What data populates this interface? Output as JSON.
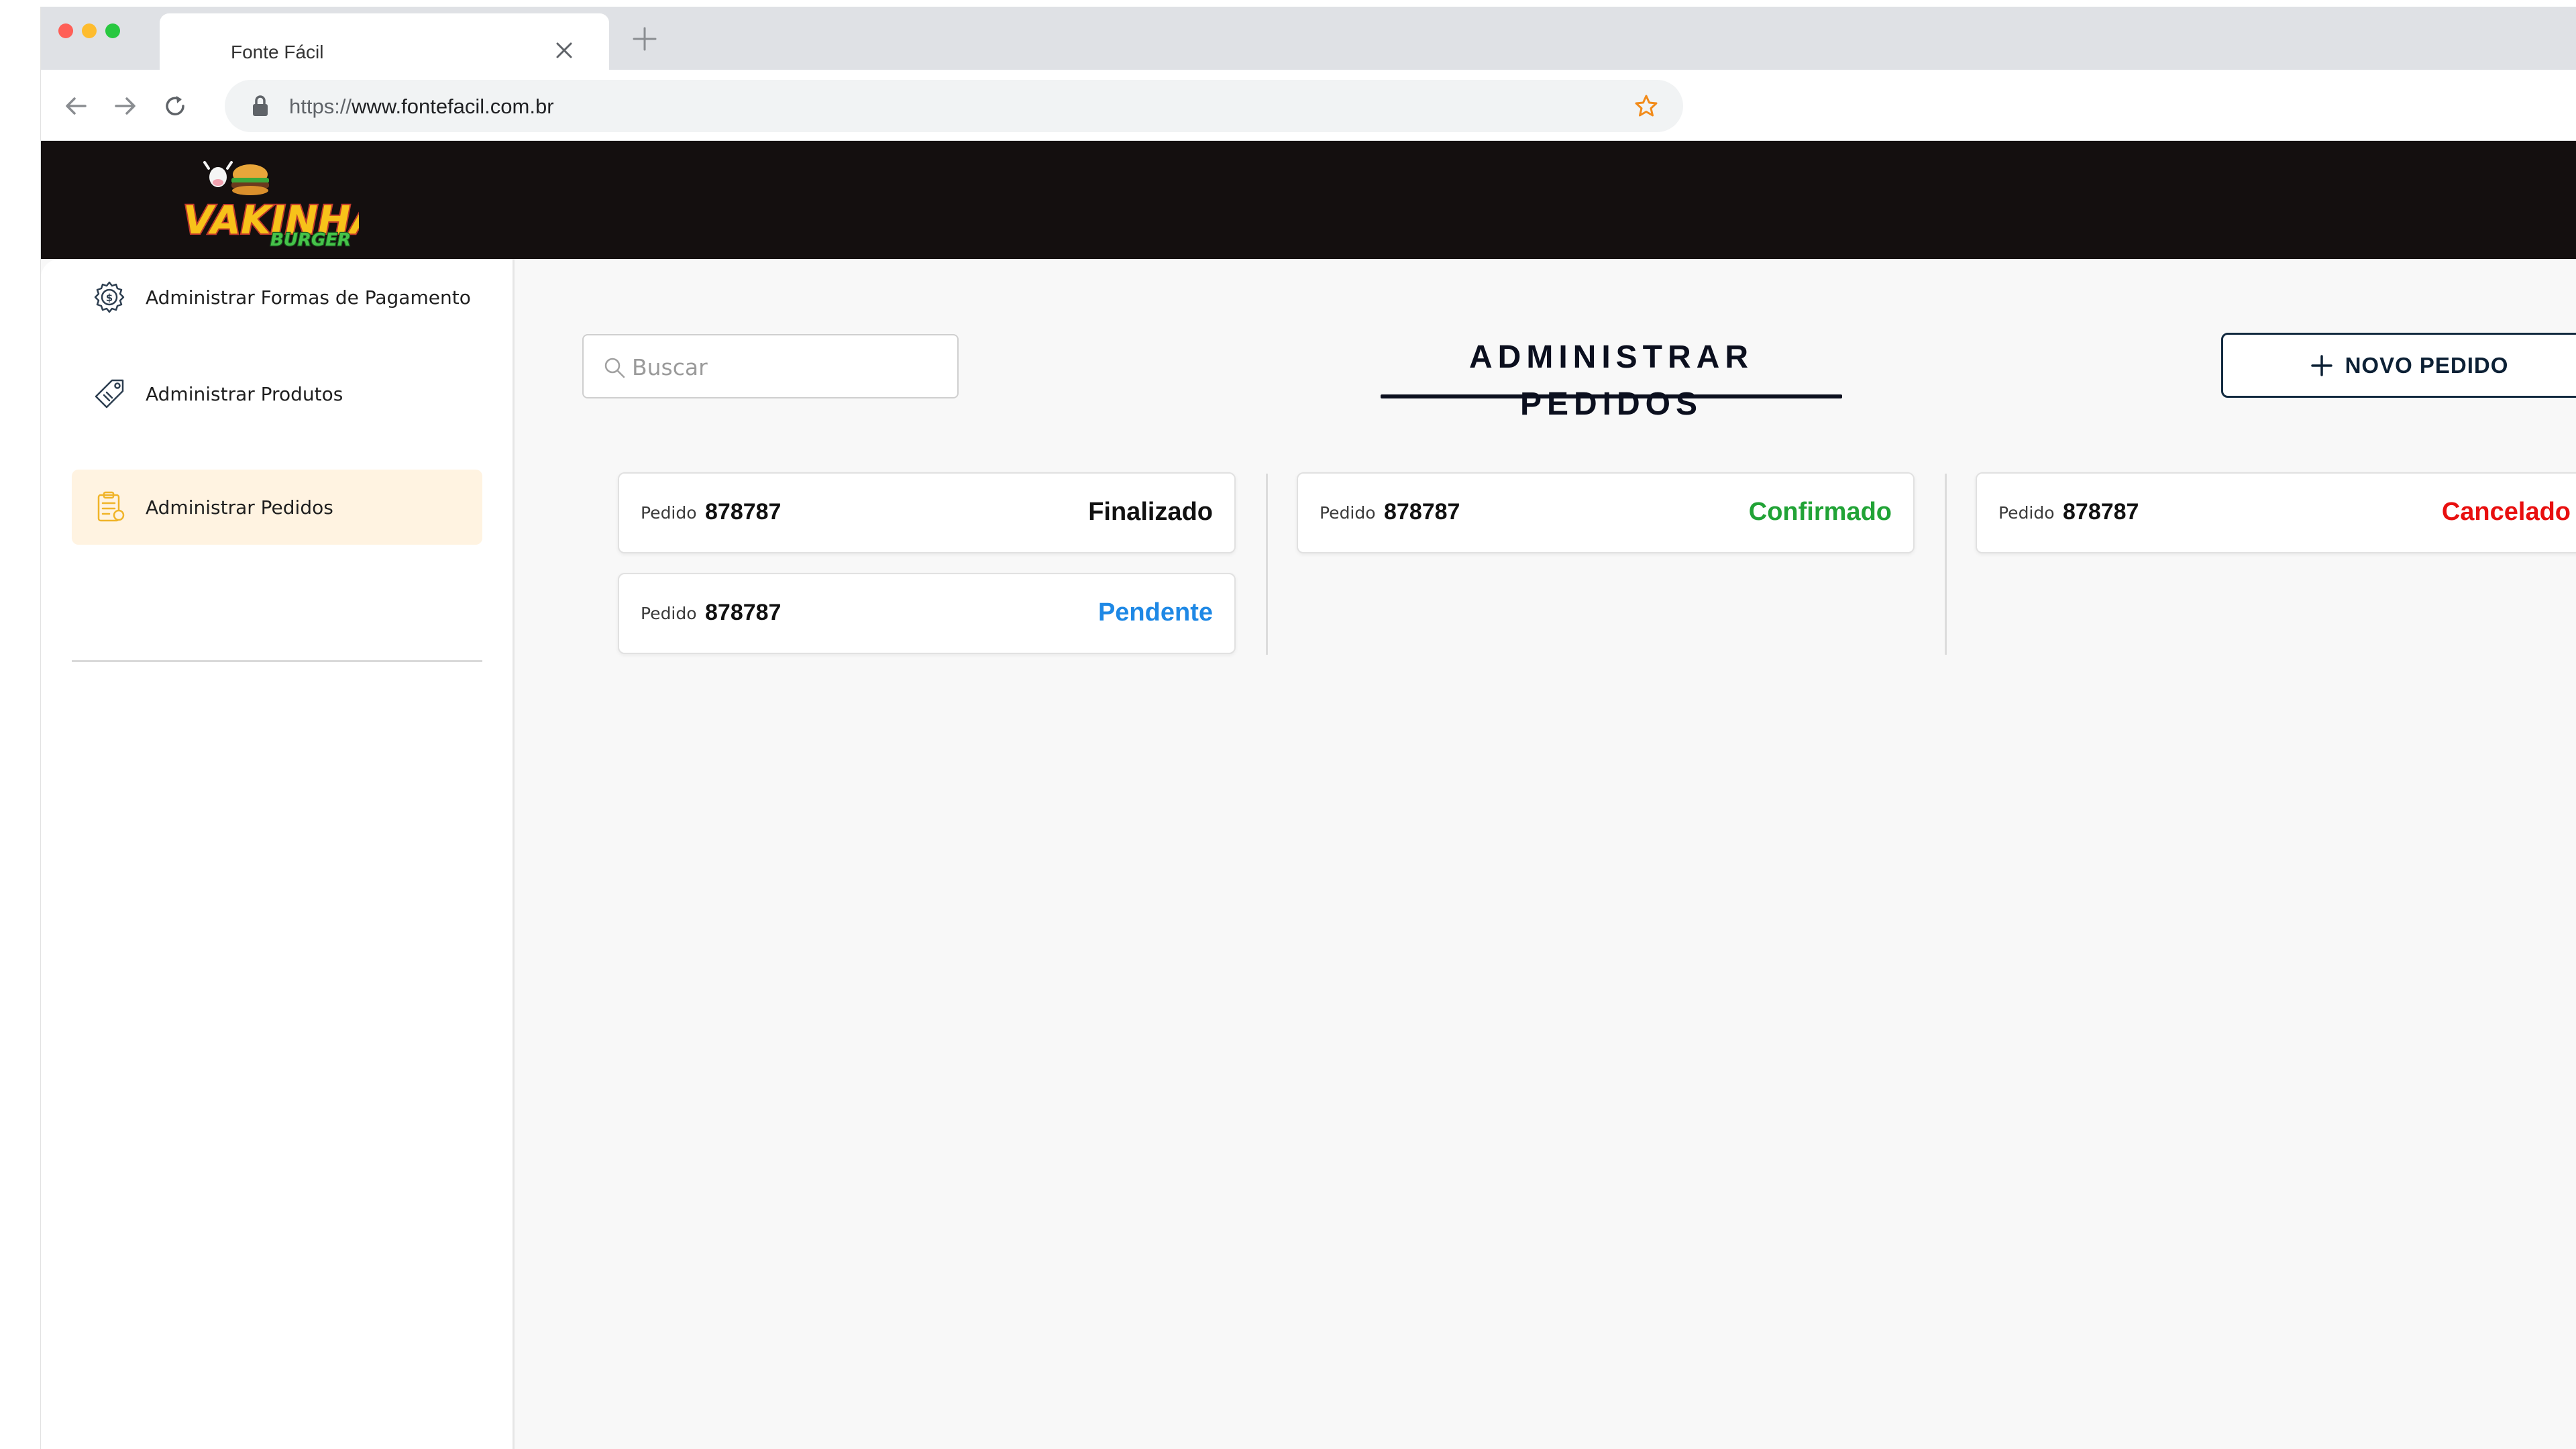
{
  "browser": {
    "tab_title": "Fonte Fácil",
    "url_scheme": "https://",
    "url_host": "www.fontefacil.com.br"
  },
  "brand": {
    "logo_text": "VAKINHA",
    "logo_subtext": "BURGER"
  },
  "sidebar": {
    "items": [
      {
        "label": "Administrar Formas de Pagamento",
        "icon": "payment-settings-icon"
      },
      {
        "label": "Administrar Produtos",
        "icon": "product-tag-icon"
      },
      {
        "label": "Administrar Pedidos",
        "icon": "orders-list-icon",
        "active": true
      }
    ]
  },
  "main": {
    "search_placeholder": "Buscar",
    "title": "ADMINISTRAR PEDIDOS",
    "new_button_label": "NOVO PEDIDO",
    "orders": [
      {
        "label": "Pedido",
        "number": "878787",
        "status": "Finalizado",
        "status_color": "#111111"
      },
      {
        "label": "Pedido",
        "number": "878787",
        "status": "Pendente",
        "status_color": "#1e88e5"
      },
      {
        "label": "Pedido",
        "number": "878787",
        "status": "Confirmado",
        "status_color": "#21a336"
      },
      {
        "label": "Pedido",
        "number": "878787",
        "status": "Cancelado",
        "status_color": "#e80f0f"
      }
    ]
  },
  "colors": {
    "header_bg": "#140f0f",
    "active_item_bg": "#fff3e1",
    "primary": "#122a3f"
  }
}
